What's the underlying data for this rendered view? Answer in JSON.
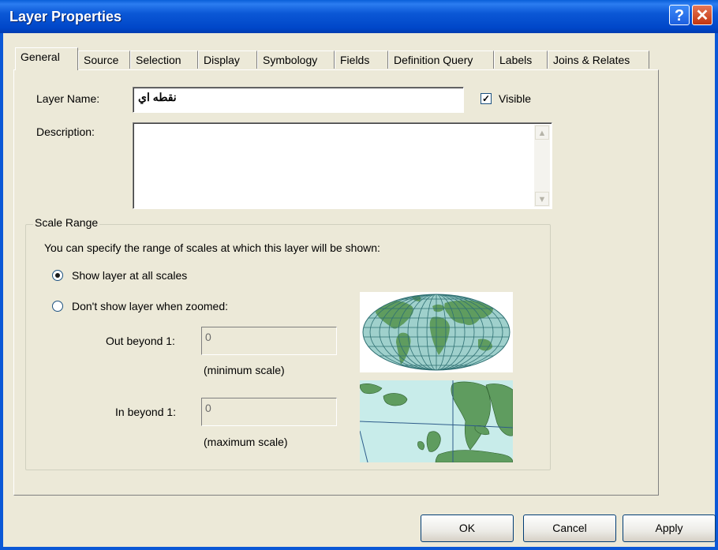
{
  "window": {
    "title": "Layer Properties"
  },
  "tabs": [
    "General",
    "Source",
    "Selection",
    "Display",
    "Symbology",
    "Fields",
    "Definition Query",
    "Labels",
    "Joins & Relates"
  ],
  "general": {
    "layer_name_label": "Layer Name:",
    "layer_name_value": "نقطه اي",
    "visible_label": "Visible",
    "visible_checked": true,
    "description_label": "Description:",
    "description_value": ""
  },
  "scale_range": {
    "title": "Scale Range",
    "info": "You can specify the range of scales at which this layer will be shown:",
    "option_all": "Show layer at all scales",
    "option_zoomed": "Don't show layer when zoomed:",
    "selected": "option_all",
    "out_label": "Out beyond  1:",
    "out_value": "0",
    "out_hint": "(minimum scale)",
    "in_label": "In beyond  1:",
    "in_value": "0",
    "in_hint": "(maximum scale)"
  },
  "buttons": {
    "ok": "OK",
    "cancel": "Cancel",
    "apply": "Apply"
  },
  "colors": {
    "titlebar": "#0b58d6",
    "dialog": "#ece9d8",
    "map_land": "#5f9c5f",
    "map_sea": "#c8ecea"
  }
}
